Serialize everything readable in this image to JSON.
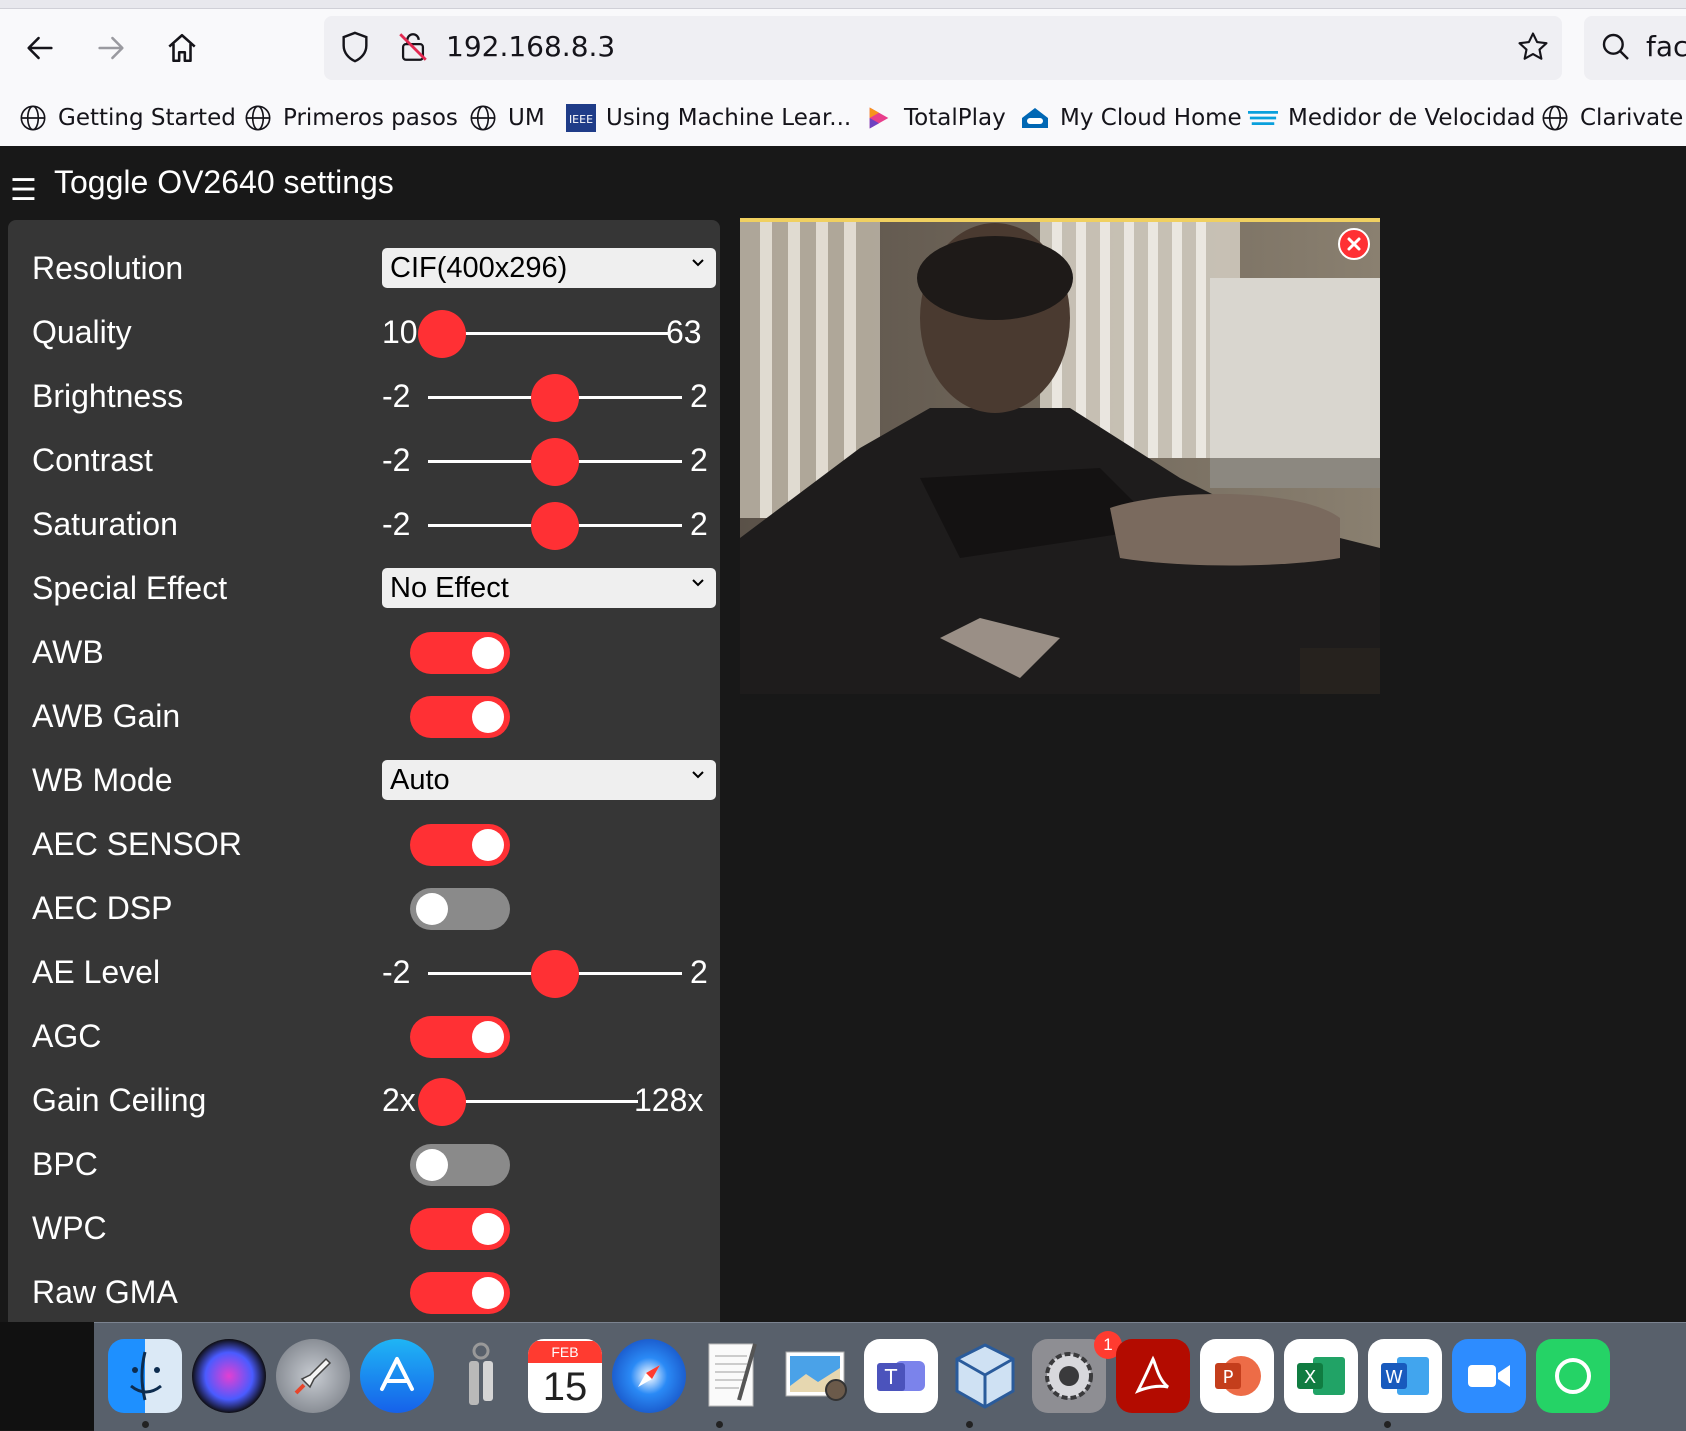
{
  "browser": {
    "url": "192.168.8.3",
    "search_text": "fac",
    "bookmarks": [
      {
        "label": "Getting Started",
        "icon": "globe-icon"
      },
      {
        "label": "Primeros pasos",
        "icon": "globe-icon"
      },
      {
        "label": "UM",
        "icon": "globe-icon"
      },
      {
        "label": "Using Machine Lear...",
        "icon": "ieee-icon"
      },
      {
        "label": "TotalPlay",
        "icon": "totalplay-icon"
      },
      {
        "label": "My Cloud Home",
        "icon": "cloud-icon"
      },
      {
        "label": "Medidor de Velocidad",
        "icon": "speedtest-icon"
      },
      {
        "label": "Clarivate",
        "icon": "globe-icon"
      }
    ]
  },
  "page": {
    "menu_icon": "hamburger-icon",
    "toggle_label": "Toggle OV2640 settings",
    "accent_color": "#ff3034",
    "settings": {
      "resolution": {
        "label": "Resolution",
        "value": "CIF(400x296)"
      },
      "quality": {
        "label": "Quality",
        "min": "10",
        "max": "63",
        "value": 10
      },
      "brightness": {
        "label": "Brightness",
        "min": "-2",
        "max": "2",
        "value": 0
      },
      "contrast": {
        "label": "Contrast",
        "min": "-2",
        "max": "2",
        "value": 0
      },
      "saturation": {
        "label": "Saturation",
        "min": "-2",
        "max": "2",
        "value": 0
      },
      "special_effect": {
        "label": "Special Effect",
        "value": "No Effect"
      },
      "awb": {
        "label": "AWB",
        "on": true
      },
      "awb_gain": {
        "label": "AWB Gain",
        "on": true
      },
      "wb_mode": {
        "label": "WB Mode",
        "value": "Auto"
      },
      "aec_sensor": {
        "label": "AEC SENSOR",
        "on": true
      },
      "aec_dsp": {
        "label": "AEC DSP",
        "on": false
      },
      "ae_level": {
        "label": "AE Level",
        "min": "-2",
        "max": "2",
        "value": 0
      },
      "agc": {
        "label": "AGC",
        "on": true
      },
      "gain_ceiling": {
        "label": "Gain Ceiling",
        "min": "2x",
        "max": "128x",
        "value": 0
      },
      "bpc": {
        "label": "BPC",
        "on": false
      },
      "wpc": {
        "label": "WPC",
        "on": true
      },
      "raw_gma": {
        "label": "Raw GMA",
        "on": true
      }
    }
  },
  "dock": {
    "apps": [
      "finder-icon",
      "siri-icon",
      "launchpad-icon",
      "app-store-icon",
      "keychain-icon",
      "calendar-icon",
      "safari-icon",
      "textedit-icon",
      "preview-icon",
      "teams-icon",
      "virtualbox-icon",
      "system-preferences-icon",
      "acrobat-icon",
      "powerpoint-icon",
      "excel-icon",
      "word-icon",
      "zoom-icon",
      "whatsapp-icon"
    ],
    "calendar_month": "FEB",
    "calendar_day": "15",
    "settings_badge": "1"
  }
}
